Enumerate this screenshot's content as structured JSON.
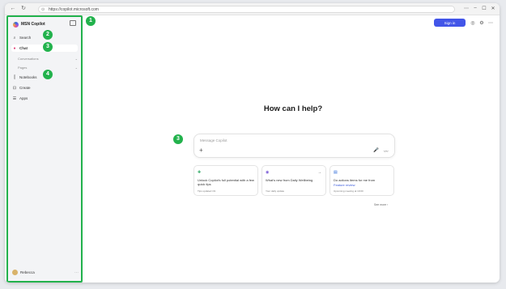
{
  "browser": {
    "url": "https://copilot.microsoft.com",
    "back_glyph": "←",
    "refresh_glyph": "↻",
    "lock_glyph": "⊙",
    "controls": [
      "⋯",
      "–",
      "☐",
      "✕"
    ]
  },
  "sidebar": {
    "brand": "MSN Copilot",
    "items": [
      {
        "label": "Search",
        "icon": "⌕"
      },
      {
        "label": "Chat",
        "icon": "●"
      }
    ],
    "sub_items": [
      {
        "label": "Conversations",
        "chevron": "⌄"
      },
      {
        "label": "Pages",
        "chevron": "⌄"
      }
    ],
    "items2": [
      {
        "label": "Notebooks",
        "icon": "⫿"
      },
      {
        "label": "Create",
        "icon": "⊡"
      },
      {
        "label": "Apps",
        "icon": "☰"
      }
    ],
    "profile_name": "Rebecca",
    "profile_more": "⋯"
  },
  "badges": [
    "1",
    "2",
    "3",
    "4",
    "3"
  ],
  "header": {
    "signin_label": "Sign in",
    "icons": [
      "◎",
      "⚙",
      "⋯"
    ]
  },
  "main": {
    "heading": "How can I help?",
    "composer": {
      "placeholder": "Message Copilot",
      "plus_glyph": "+",
      "mic_glyph": "🎤",
      "voice_glyph": "〰"
    },
    "cards": [
      {
        "icon": "✚",
        "arrow": "",
        "title": "Unlock Copilot's full potential with a few quick tips",
        "extra": "",
        "meta": "Tips updated 1hr"
      },
      {
        "icon": "◉",
        "arrow": "→",
        "title": "What's new from Daily Wellbeing",
        "extra": "",
        "meta": "Your daily update"
      },
      {
        "icon": "▤",
        "arrow": "",
        "title": "Do actions items for me from",
        "extra": "Feature review",
        "meta": "Upcoming meeting at 10:00"
      }
    ],
    "see_all": "See more ›"
  },
  "colors": {
    "accent": "#4255e8",
    "highlight": "#22b24c",
    "sidebar_bg": "#f3f4f6"
  }
}
